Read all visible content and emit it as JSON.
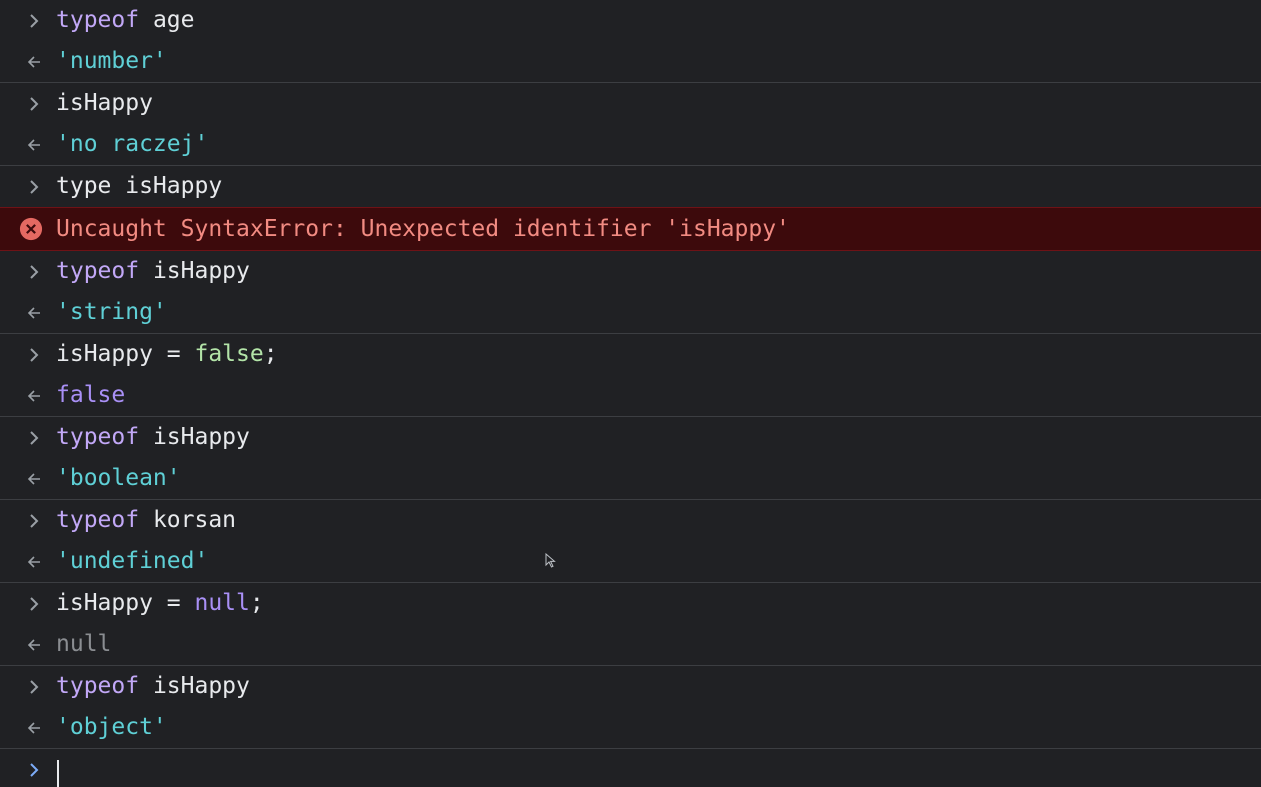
{
  "console": {
    "entries": [
      {
        "input_kw": "typeof",
        "input_rest": " age",
        "result": "'number'"
      },
      {
        "input": "isHappy",
        "result": "'no raczej'"
      },
      {
        "input": "type isHappy",
        "error": "Uncaught SyntaxError: Unexpected identifier 'isHappy'"
      },
      {
        "input_kw": "typeof",
        "input_rest": " isHappy",
        "result": "'string'"
      },
      {
        "input_head": "isHappy = ",
        "input_lit": "false",
        "input_tail": ";",
        "result": "false"
      },
      {
        "input_kw": "typeof",
        "input_rest": " isHappy",
        "result": "'boolean'"
      },
      {
        "input_kw": "typeof",
        "input_rest": " korsan",
        "result": "'undefined'"
      },
      {
        "input_head": "isHappy = ",
        "input_lit": "null",
        "input_tail": ";",
        "result": "null"
      },
      {
        "input_kw": "typeof",
        "input_rest": " isHappy",
        "result": "'object'"
      }
    ],
    "prompt_value": ""
  },
  "icons": {
    "input_prompt": "chevron-right-icon",
    "result_arrow": "return-arrow-icon",
    "error": "error-circle-icon",
    "cursor": "mouse-pointer-icon"
  },
  "colors": {
    "background": "#202124",
    "keyword": "#c2a8f7",
    "string": "#5fd0d6",
    "error_text": "#f28b82",
    "error_background": "#3d0a0c",
    "error_icon": "#e46962",
    "prompt_active": "#7cacf8"
  }
}
